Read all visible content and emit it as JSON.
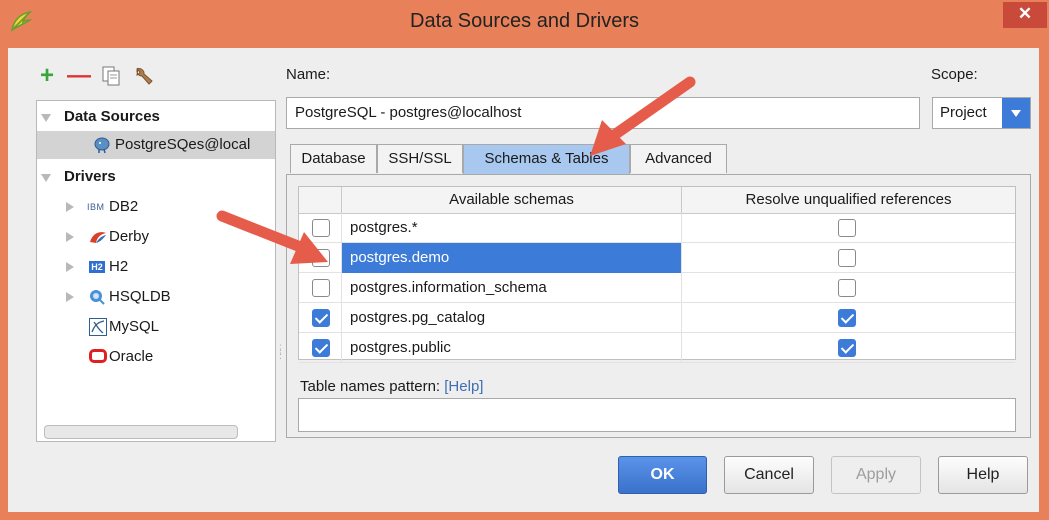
{
  "window": {
    "title": "Data Sources and Drivers",
    "close_symbol": "✕"
  },
  "colors": {
    "titlebar": "#e8815a",
    "accent": "#3d7bd9",
    "arrow": "#e65c4a",
    "add": "#3aa43a",
    "remove": "#d33333"
  },
  "toolbar": {
    "add_symbol": "+",
    "remove_symbol": "—",
    "icons": [
      "plus-icon",
      "minus-icon",
      "copy-icon",
      "wrench-icon"
    ]
  },
  "tree": {
    "data_sources_heading": "Data Sources",
    "data_source_item": "PostgreSQes@local",
    "drivers_heading": "Drivers",
    "drivers": [
      {
        "label": "DB2",
        "icon": "ibm-icon",
        "prefix": "IBM"
      },
      {
        "label": "Derby",
        "icon": "derby-icon"
      },
      {
        "label": "H2",
        "icon": "h2-icon",
        "prefix": "H2"
      },
      {
        "label": "HSQLDB",
        "icon": "hsqldb-icon"
      },
      {
        "label": "MySQL",
        "icon": "mysql-icon"
      },
      {
        "label": "Oracle",
        "icon": "oracle-icon"
      }
    ]
  },
  "form": {
    "name_label": "Name:",
    "name_value": "PostgreSQL - postgres@localhost",
    "scope_label": "Scope:",
    "scope_value": "Project"
  },
  "tabs": [
    {
      "label": "Database",
      "active": false
    },
    {
      "label": "SSH/SSL",
      "active": false
    },
    {
      "label": "Schemas & Tables",
      "active": true
    },
    {
      "label": "Advanced",
      "active": false
    }
  ],
  "schemas": {
    "columns": [
      "Available schemas",
      "Resolve unqualified references"
    ],
    "rows": [
      {
        "name": "postgres.*",
        "available": false,
        "resolve": false,
        "selected": false
      },
      {
        "name": "postgres.demo",
        "available": false,
        "resolve": false,
        "selected": true
      },
      {
        "name": "postgres.information_schema",
        "available": false,
        "resolve": false,
        "selected": false
      },
      {
        "name": "postgres.pg_catalog",
        "available": true,
        "resolve": true,
        "selected": false
      },
      {
        "name": "postgres.public",
        "available": true,
        "resolve": true,
        "selected": false
      }
    ]
  },
  "pattern": {
    "label": "Table names pattern:",
    "help": "[Help]",
    "value": ""
  },
  "buttons": {
    "ok": "OK",
    "cancel": "Cancel",
    "apply": "Apply",
    "help": "Help"
  }
}
